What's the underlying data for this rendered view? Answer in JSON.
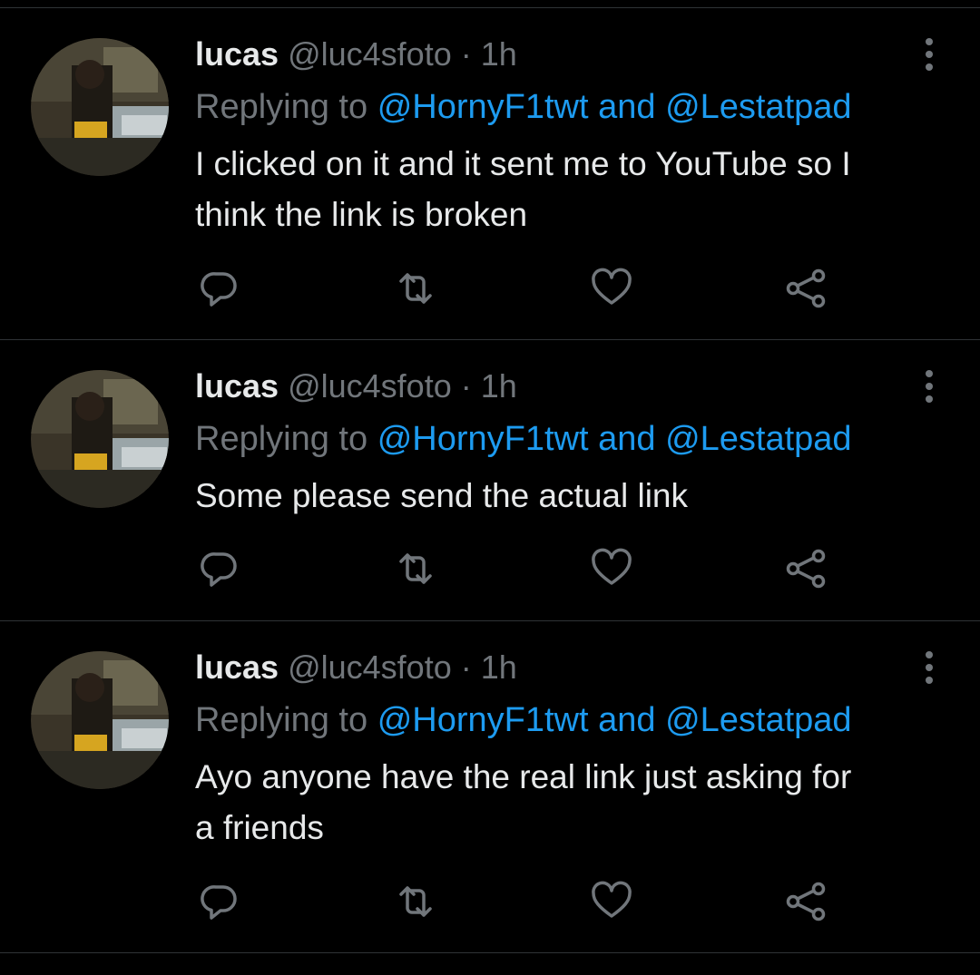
{
  "tweets": [
    {
      "name": "lucas",
      "handle": "@luc4sfoto",
      "dot": "·",
      "time": "1h",
      "replying_prefix": "Replying to",
      "mention1": "@HornyF1twt",
      "and": "and",
      "mention2": "@Lestatpad",
      "text_line1": "I clicked on it and it sent me to YouTube so I",
      "text_line2": "think the link is broken"
    },
    {
      "name": "lucas",
      "handle": "@luc4sfoto",
      "dot": "·",
      "time": "1h",
      "replying_prefix": "Replying to",
      "mention1": "@HornyF1twt",
      "and": "and",
      "mention2": "@Lestatpad",
      "text_line1": "Some please send the actual link",
      "text_line2": ""
    },
    {
      "name": "lucas",
      "handle": "@luc4sfoto",
      "dot": "·",
      "time": "1h",
      "replying_prefix": "Replying to",
      "mention1": "@HornyF1twt",
      "and": "and",
      "mention2": "@Lestatpad",
      "text_line1": "Ayo anyone have the real link just asking for",
      "text_line2": "a friends"
    }
  ],
  "icons": {
    "reply": "reply-icon",
    "retweet": "retweet-icon",
    "like": "like-icon",
    "share": "share-icon",
    "more": "more-vertical-icon"
  },
  "colors": {
    "background": "#000000",
    "text": "#e7e9ea",
    "muted": "#71767b",
    "link": "#1d9bf0",
    "divider": "#2f3336"
  }
}
